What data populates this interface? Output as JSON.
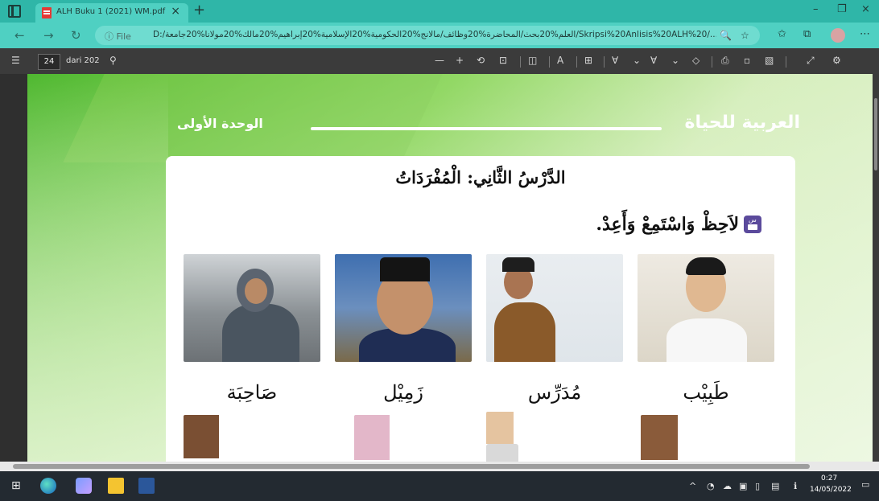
{
  "browser": {
    "tab_title": "ALH Buku 1 (2021) WM.pdf",
    "tab_close": "×",
    "new_tab": "+",
    "minimize": "–",
    "restore": "❐",
    "close": "×",
    "url_info": "ⓘ File",
    "url": "D:/العلم%20بحث/المحاضرة%20وظائف/مالانج%20الحكومية%20الإسلامية%20إبراهيم%20مالك%20مولانا%20جامعة/Skripsi%20Anlisis%20ALH%20/..."
  },
  "pdf_toolbar": {
    "page_number": "24",
    "page_of": "dari 202"
  },
  "page": {
    "book_title": "العربية للحياة",
    "unit": "الوحدة الأولى",
    "lesson_title": "الدَّرْسُ الثَّانِي: الْمُفْرَدَاتُ",
    "instruction": "لاَحِظْ وَاسْتَمِعْ وَأَعِدْ."
  },
  "vocab_row1": [
    {
      "word": "طَبِيْب"
    },
    {
      "word": "مُدَرِّس"
    },
    {
      "word": "زَمِيْل"
    },
    {
      "word": "صَاحِبَة"
    }
  ],
  "taskbar": {
    "time": "0:27",
    "date": "14/05/2022"
  }
}
